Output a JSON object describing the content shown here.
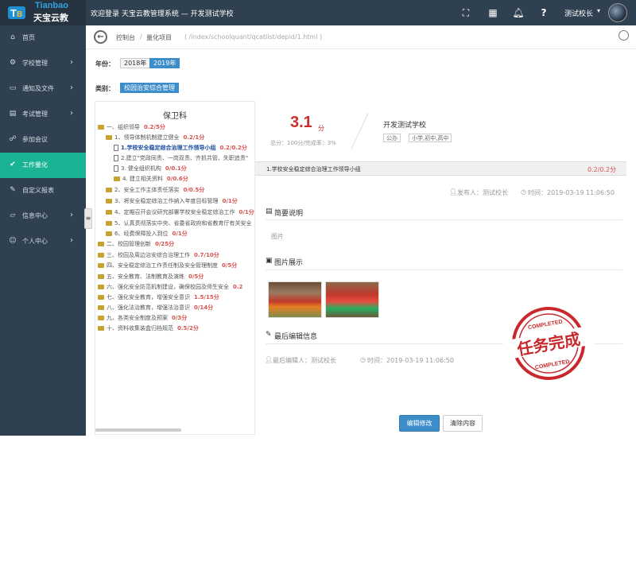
{
  "header": {
    "logo_en": "Tianbao",
    "logo_cn": "天宝云教",
    "welcome": "欢迎登录 天宝云教管理系统 — 开发测试学校",
    "user_name": "测试校长",
    "icons": [
      "fullscreen-icon",
      "qrcode-icon",
      "bell-icon",
      "help-icon"
    ]
  },
  "sidebar": {
    "items": [
      {
        "label": "首页",
        "icon": "home-icon",
        "arrow": false,
        "active": false
      },
      {
        "label": "学校管理",
        "icon": "gear-icon",
        "arrow": true,
        "active": false
      },
      {
        "label": "通知及文件",
        "icon": "folder-icon",
        "arrow": true,
        "active": false
      },
      {
        "label": "考试管理",
        "icon": "book-icon",
        "arrow": true,
        "active": false
      },
      {
        "label": "参加会议",
        "icon": "users-icon",
        "arrow": false,
        "active": false
      },
      {
        "label": "工作量化",
        "icon": "check-icon",
        "arrow": false,
        "active": true
      },
      {
        "label": "自定义报表",
        "icon": "edit-icon",
        "arrow": false,
        "active": false
      },
      {
        "label": "信息中心",
        "icon": "folder-open-icon",
        "arrow": true,
        "active": false
      },
      {
        "label": "个人中心",
        "icon": "user-icon",
        "arrow": true,
        "active": false
      }
    ]
  },
  "breadcrumb": {
    "items": [
      "控制台",
      "量化项目"
    ],
    "separator": "/",
    "path": "( /index/schoolquant/qcatlist/depid/1.html )"
  },
  "filters": {
    "year_label": "年份：",
    "years": [
      "2018年",
      "2019年"
    ],
    "selected_year": "2019年",
    "category_label": "类别：",
    "categories": [
      "校园治安综合管理"
    ]
  },
  "tree": {
    "title": "保卫科",
    "rows": [
      {
        "text": "一、组织领导",
        "score": "0.2/5分",
        "type": "folder"
      },
      {
        "text": "1、领导体制机制建立健全",
        "score": "0.2/1分",
        "type": "folder"
      },
      {
        "text": "1.学校安全稳定综合治理工作领导小组",
        "score": "0.2/0.2分",
        "type": "doc"
      },
      {
        "text": "2.建立\"党政同责、一岗双责、齐抓共管、失职追责\"",
        "score": "",
        "type": "doc"
      },
      {
        "text": "3. 健全组织机构",
        "score": "0/0.1分",
        "type": "doc"
      },
      {
        "text": "4. 建立相关资料",
        "score": "0/0.6分",
        "type": "folder"
      },
      {
        "text": "2、安全工作主体责任落实",
        "score": "0/0.5分",
        "type": "folder"
      },
      {
        "text": "3、将安全稳定综治工作纳入年度目标管理",
        "score": "0/1分",
        "type": "folder"
      },
      {
        "text": "4、定期召开会议研究部署学校安全稳定综治工作",
        "score": "0/1分",
        "type": "folder"
      },
      {
        "text": "5、认真贯彻落实中央、省委省政府和省教育厅有关安全",
        "score": "",
        "type": "folder"
      },
      {
        "text": "6、经费保障投入到位",
        "score": "0/1分",
        "type": "folder"
      },
      {
        "text": "二、校园管理创新",
        "score": "0/25分",
        "type": "folder"
      },
      {
        "text": "三、校园及周边治安综合治理工作",
        "score": "0.7/10分",
        "type": "folder"
      },
      {
        "text": "四、安全稳定综治工作责任制及安全管理制度",
        "score": "0/5分",
        "type": "folder"
      },
      {
        "text": "五、安全教育、法制教育及演练",
        "score": "0/5分",
        "type": "folder"
      },
      {
        "text": "六、强化安全防范机制建设，确保校园及师生安全",
        "score": "0.2",
        "type": "folder"
      },
      {
        "text": "七、强化安全教育，增强安全意识",
        "score": "1.5/15分",
        "type": "folder"
      },
      {
        "text": "八、强化法治教育，增强法治意识",
        "score": "0/14分",
        "type": "folder"
      },
      {
        "text": "九、各类安全制度及预案",
        "score": "0/3分",
        "type": "folder"
      },
      {
        "text": "十、资料收集装盒归档规范",
        "score": "0.5/2分",
        "type": "folder"
      }
    ]
  },
  "summary": {
    "score": "3.1",
    "score_unit": "分",
    "sub": "总分：100分/完成率：3%",
    "school": "开发测试学校",
    "tags": [
      "公办",
      "小学,初中,高中"
    ]
  },
  "item": {
    "title": "1.学校安全稳定综合治理工作领导小组",
    "score": "0.2/0.2分",
    "publisher": "发布人：测试校长",
    "time": "时间：2019-03-19 11:06:50"
  },
  "sections": {
    "brief_title": "简要说明",
    "brief_text": "图片",
    "photos_title": "图片展示",
    "last_edit_title": "最后编辑信息",
    "last_editor": "最后编辑人：测试校长",
    "last_time": "时间：2019-03-19 11:06:50"
  },
  "stamp": {
    "main": "任务完成",
    "top": "COMPLETED",
    "bottom": "COMPLETED",
    "color": "#c9272b"
  },
  "buttons": {
    "edit": "编辑修改",
    "clear": "清除内容"
  }
}
